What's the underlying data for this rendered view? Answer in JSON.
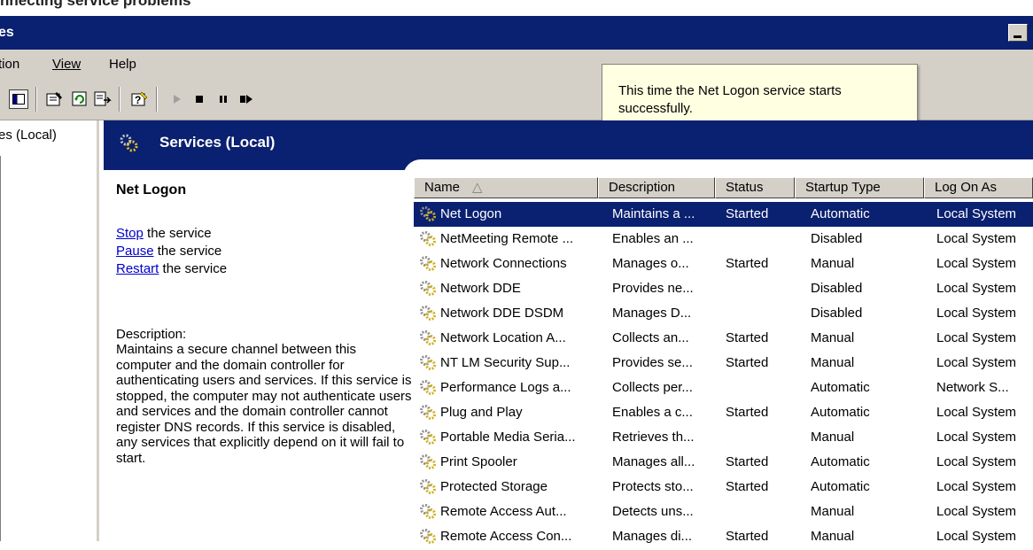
{
  "page_caption": "nnecting service problems",
  "window": {
    "title": "es"
  },
  "menu": [
    "tion",
    "View",
    "Help"
  ],
  "left_pane": {
    "tree_item": "es (Local)"
  },
  "header": {
    "title": "Services (Local)"
  },
  "selected_service": {
    "name": "Net Logon",
    "actions": [
      {
        "link": "Stop",
        "text": " the service"
      },
      {
        "link": "Pause",
        "text": " the service"
      },
      {
        "link": "Restart",
        "text": " the service"
      }
    ],
    "description_label": "Description:",
    "description": "Maintains a secure channel between this computer and the domain controller for authenticating users and services. If this service is stopped, the computer may not authenticate users and services and the domain controller cannot register DNS records. If this service is disabled, any services that explicitly depend on it will fail to start."
  },
  "table": {
    "columns": [
      "Name",
      "Description",
      "Status",
      "Startup Type",
      "Log On As"
    ],
    "sort_indicator": "△",
    "rows": [
      {
        "name": "Net Logon",
        "description": "Maintains a ...",
        "status": "Started",
        "startup": "Automatic",
        "logon": "Local System"
      },
      {
        "name": "NetMeeting Remote ...",
        "description": "Enables an ...",
        "status": "",
        "startup": "Disabled",
        "logon": "Local System"
      },
      {
        "name": "Network Connections",
        "description": "Manages o...",
        "status": "Started",
        "startup": "Manual",
        "logon": "Local System"
      },
      {
        "name": "Network DDE",
        "description": "Provides ne...",
        "status": "",
        "startup": "Disabled",
        "logon": "Local System"
      },
      {
        "name": "Network DDE DSDM",
        "description": "Manages D...",
        "status": "",
        "startup": "Disabled",
        "logon": "Local System"
      },
      {
        "name": "Network Location A...",
        "description": "Collects an...",
        "status": "Started",
        "startup": "Manual",
        "logon": "Local System"
      },
      {
        "name": "NT LM Security Sup...",
        "description": "Provides se...",
        "status": "Started",
        "startup": "Manual",
        "logon": "Local System"
      },
      {
        "name": "Performance Logs a...",
        "description": "Collects per...",
        "status": "",
        "startup": "Automatic",
        "logon": "Network S..."
      },
      {
        "name": "Plug and Play",
        "description": "Enables a c...",
        "status": "Started",
        "startup": "Automatic",
        "logon": "Local System"
      },
      {
        "name": "Portable Media Seria...",
        "description": "Retrieves th...",
        "status": "",
        "startup": "Manual",
        "logon": "Local System"
      },
      {
        "name": "Print Spooler",
        "description": "Manages all...",
        "status": "Started",
        "startup": "Automatic",
        "logon": "Local System"
      },
      {
        "name": "Protected Storage",
        "description": "Protects sto...",
        "status": "Started",
        "startup": "Automatic",
        "logon": "Local System"
      },
      {
        "name": "Remote Access Aut...",
        "description": "Detects uns...",
        "status": "",
        "startup": "Manual",
        "logon": "Local System"
      },
      {
        "name": "Remote Access Con...",
        "description": "Manages di...",
        "status": "Started",
        "startup": "Manual",
        "logon": "Local System"
      }
    ],
    "selected_index": 0
  },
  "tooltip": {
    "text": "This time the Net Logon service starts successfully."
  },
  "toolbar_icons": [
    "show-hide-tree-icon",
    "properties-icon",
    "refresh-icon",
    "export-list-icon",
    "help-icon",
    "start-service-icon",
    "stop-service-icon",
    "pause-service-icon",
    "restart-service-icon"
  ],
  "colors": {
    "title_bar": "#0a2070",
    "chrome": "#d4d0c8",
    "tooltip_bg": "#ffffe1",
    "link": "#0000cc",
    "selection": "#0a2070"
  }
}
